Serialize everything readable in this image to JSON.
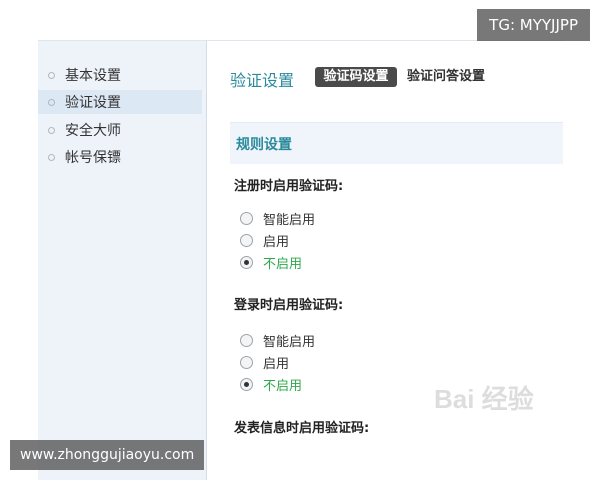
{
  "sidebar": {
    "items": [
      {
        "label": "基本设置",
        "active": false
      },
      {
        "label": "验证设置",
        "active": true
      },
      {
        "label": "安全大师",
        "active": false
      },
      {
        "label": "帐号保镖",
        "active": false
      }
    ]
  },
  "main": {
    "title": "验证设置",
    "tabs": [
      {
        "label": "验证码设置",
        "active": true
      },
      {
        "label": "验证问答设置",
        "active": false
      }
    ],
    "section_title": "规则设置",
    "groups": [
      {
        "label": "注册时启用验证码:",
        "options": [
          {
            "label": "智能启用",
            "checked": false
          },
          {
            "label": "启用",
            "checked": false
          },
          {
            "label": "不启用",
            "checked": true
          }
        ]
      },
      {
        "label": "登录时启用验证码:",
        "options": [
          {
            "label": "智能启用",
            "checked": false
          },
          {
            "label": "启用",
            "checked": false
          },
          {
            "label": "不启用",
            "checked": true
          }
        ]
      },
      {
        "label": "发表信息时启用验证码:"
      }
    ]
  },
  "watermarks": {
    "tg": "TG: MYYJJPP",
    "site": "www.zhonggujiaoyu.com",
    "baidu": "Bai 经验"
  },
  "colors": {
    "accent_teal": "#2a8a9c",
    "checked_green": "#2da84a",
    "sidebar_bg": "#eef3fa",
    "tab_active_bg": "#4a4a4a"
  }
}
